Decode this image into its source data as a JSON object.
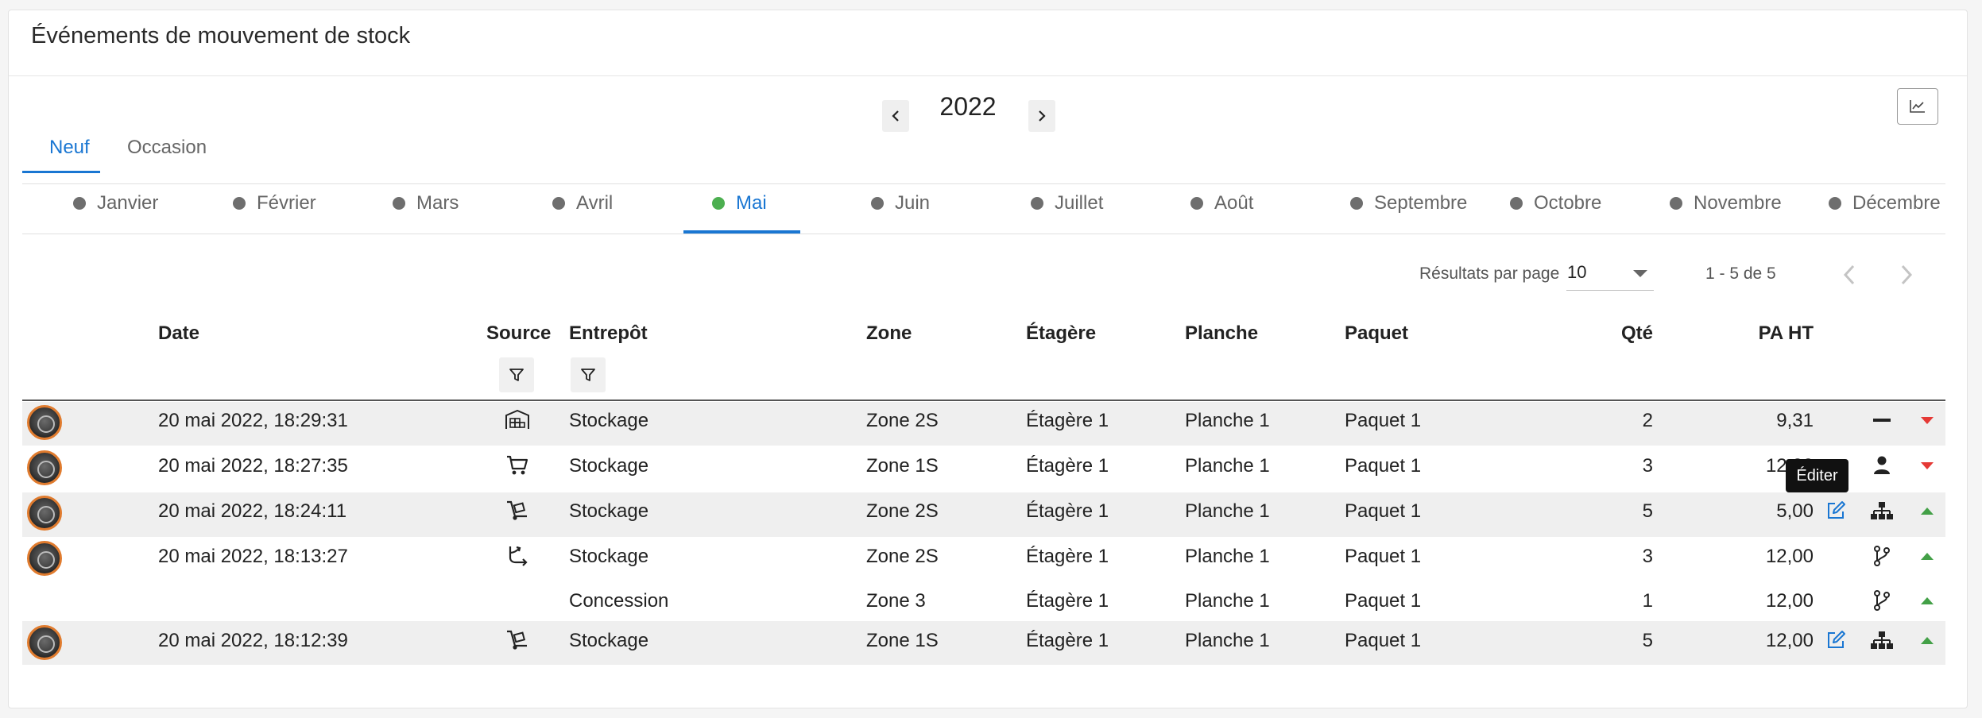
{
  "title": "Événements de mouvement de stock",
  "year": {
    "prev_icon": "chevron-left-icon",
    "value": "2022",
    "next_icon": "chevron-right-icon"
  },
  "chart_toggle_icon": "line-chart-icon",
  "tabs": [
    {
      "label": "Neuf",
      "active": true
    },
    {
      "label": "Occasion",
      "active": false
    }
  ],
  "months": [
    {
      "label": "Janvier",
      "active": false
    },
    {
      "label": "Février",
      "active": false
    },
    {
      "label": "Mars",
      "active": false
    },
    {
      "label": "Avril",
      "active": false
    },
    {
      "label": "Mai",
      "active": true
    },
    {
      "label": "Juin",
      "active": false
    },
    {
      "label": "Juillet",
      "active": false
    },
    {
      "label": "Août",
      "active": false
    },
    {
      "label": "Septembre",
      "active": false
    },
    {
      "label": "Octobre",
      "active": false
    },
    {
      "label": "Novembre",
      "active": false
    },
    {
      "label": "Décembre",
      "active": false
    }
  ],
  "pagination": {
    "per_page_label": "Résultats par page",
    "per_page_value": "10",
    "range": "1 - 5 de 5"
  },
  "columns": {
    "date": "Date",
    "source": "Source",
    "warehouse": "Entrepôt",
    "zone": "Zone",
    "shelf": "Étagère",
    "board": "Planche",
    "package": "Paquet",
    "qty": "Qté",
    "price": "PA HT"
  },
  "rows": [
    {
      "date": "20 mai 2022, 18:29:31",
      "source_icon": "warehouse-icon",
      "warehouse": "Stockage",
      "zone": "Zone 2S",
      "shelf": "Étagère 1",
      "board": "Planche 1",
      "package": "Paquet 1",
      "qty": "2",
      "price": "9,31",
      "action_icon": "minus-icon",
      "direction": "down"
    },
    {
      "date": "20 mai 2022, 18:27:35",
      "source_icon": "cart-icon",
      "warehouse": "Stockage",
      "zone": "Zone 1S",
      "shelf": "Étagère 1",
      "board": "Planche 1",
      "package": "Paquet 1",
      "qty": "3",
      "price": "12,00",
      "action_icon": "person-icon",
      "direction": "down"
    },
    {
      "date": "20 mai 2022, 18:24:11",
      "source_icon": "dolly-icon",
      "warehouse": "Stockage",
      "zone": "Zone 2S",
      "shelf": "Étagère 1",
      "board": "Planche 1",
      "package": "Paquet 1",
      "qty": "5",
      "price": "5,00",
      "action_icon": "sitemap-icon",
      "direction": "up"
    },
    {
      "date": "20 mai 2022, 18:13:27",
      "source_icon": "split-arrows-icon",
      "warehouse": "Stockage",
      "zone": "Zone 2S",
      "shelf": "Étagère 1",
      "board": "Planche 1",
      "package": "Paquet 1",
      "qty": "3",
      "price": "12,00",
      "action_icon": "branch-icon",
      "direction": "up"
    },
    {
      "date": "",
      "source_icon": "",
      "warehouse": "Concession",
      "zone": "Zone 3",
      "shelf": "Étagère 1",
      "board": "Planche 1",
      "package": "Paquet 1",
      "qty": "1",
      "price": "12,00",
      "action_icon": "branch-icon",
      "direction": "up"
    },
    {
      "date": "20 mai 2022, 18:12:39",
      "source_icon": "dolly-icon",
      "warehouse": "Stockage",
      "zone": "Zone 1S",
      "shelf": "Étagère 1",
      "board": "Planche 1",
      "package": "Paquet 1",
      "qty": "5",
      "price": "12,00",
      "action_icon": "sitemap-icon",
      "direction": "up"
    }
  ],
  "tooltip": "Éditer",
  "colors": {
    "accent": "#1976d2",
    "up": "#43a047",
    "down": "#e53935",
    "active_dot": "#4caf50"
  }
}
